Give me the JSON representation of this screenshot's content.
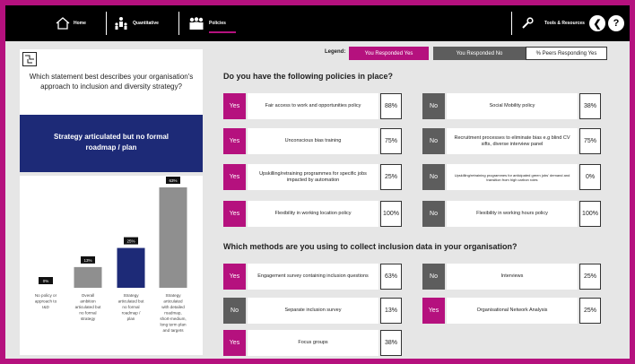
{
  "nav": {
    "home": "Home",
    "quantitative": "Quantitative",
    "policies": "Policies",
    "tools": "Tools & Resources",
    "back_glyph": "❮",
    "help_glyph": "?",
    "icons": [
      "home-icon",
      "people-chart-icon",
      "group-icon",
      "wrench-icon",
      "back-icon",
      "help-icon"
    ]
  },
  "left": {
    "question": "Which statement best describes your organisation's approach to inclusion and diversity strategy?",
    "answer": "Strategy articulated but no formal roadmap / plan",
    "highlight_color": "#1d2a77"
  },
  "chart_data": {
    "type": "bar",
    "categories": [
      [
        "No policy or",
        "approach to",
        "I&D"
      ],
      [
        "Overall",
        "ambition",
        "articulated but",
        "no formal",
        "strategy"
      ],
      [
        "Strategy",
        "articulated but",
        "no formal",
        "roadmap /",
        "plan"
      ],
      [
        "Strategy",
        "articulated",
        "with detailed",
        "roadmap,",
        "short-medium,",
        "long term plan",
        "and targets"
      ]
    ],
    "values": [
      0,
      13,
      25,
      63
    ],
    "value_labels": [
      "0%",
      "13%",
      "25%",
      "63%"
    ],
    "highlighted_index": 2,
    "ylim": [
      0,
      63
    ],
    "colors": {
      "default": "#8f8f8f",
      "highlight": "#1d2a77"
    }
  },
  "legend": {
    "label": "Legend:",
    "yes": "You Responded Yes",
    "no": "You Responded No",
    "peers": "% Peers Responding Yes"
  },
  "colors": {
    "yes": "#b5117e",
    "no": "#5d5d5d"
  },
  "section1": {
    "title": "Do you have the following policies in place?",
    "rows": [
      {
        "answer": "Yes",
        "desc": "Fair access to work and opportunities policy",
        "pct": "88%"
      },
      {
        "answer": "No",
        "desc": "Social Mobility policy",
        "pct": "38%"
      },
      {
        "answer": "Yes",
        "desc": "Unconscious bias training",
        "pct": "75%"
      },
      {
        "answer": "No",
        "desc": "Recruitment processes to eliminate bias e.g blind CV sifts, diverse interview panel",
        "pct": "75%"
      },
      {
        "answer": "Yes",
        "desc": "Upskilling/retraining programmes for specific jobs impacted by automation",
        "pct": "25%"
      },
      {
        "answer": "No",
        "desc": "Upskilling/retraining programmes for anticipated green jobs' demand and transition from high carbon roles",
        "pct": "0%"
      },
      {
        "answer": "Yes",
        "desc": "Flexibility in working location policy",
        "pct": "100%"
      },
      {
        "answer": "No",
        "desc": "Flexibility in working hours policy",
        "pct": "100%"
      }
    ]
  },
  "section2": {
    "title": "Which methods are you using to collect inclusion data in your organisation?",
    "rows": [
      {
        "answer": "Yes",
        "desc": "Engagement survey containing inclusion questions",
        "pct": "63%"
      },
      {
        "answer": "No",
        "desc": "Interviews",
        "pct": "25%"
      },
      {
        "answer": "No",
        "desc": "Separate inclusion survey",
        "pct": "13%"
      },
      {
        "answer": "Yes",
        "desc": "Organisational Network Analysis",
        "pct": "25%"
      },
      {
        "answer": "Yes",
        "desc": "Focus groups",
        "pct": "38%"
      }
    ]
  }
}
